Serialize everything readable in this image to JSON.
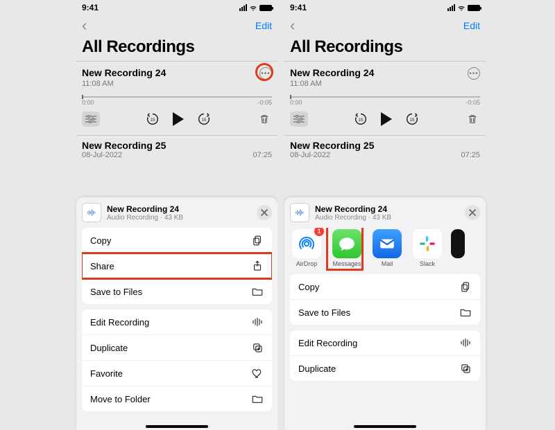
{
  "status": {
    "time": "9:41"
  },
  "nav": {
    "edit": "Edit"
  },
  "title": "All Recordings",
  "recording": {
    "title": "New Recording 24",
    "time": "11:08 AM",
    "start_time": "0:00",
    "end_time": "-0:05"
  },
  "recording2": {
    "title": "New Recording 25",
    "date": "08-Jul-2022",
    "time": "07:25"
  },
  "sheet": {
    "title": "New Recording 24",
    "subtitle": "Audio Recording · 43 KB"
  },
  "menu": {
    "copy": "Copy",
    "share": "Share",
    "save": "Save to Files",
    "edit": "Edit Recording",
    "duplicate": "Duplicate",
    "favorite": "Favorite",
    "move": "Move to Folder"
  },
  "apps": {
    "airdrop": {
      "label": "AirDrop",
      "badge": "1"
    },
    "messages": {
      "label": "Messages"
    },
    "mail": {
      "label": "Mail"
    },
    "slack": {
      "label": "Slack"
    }
  }
}
